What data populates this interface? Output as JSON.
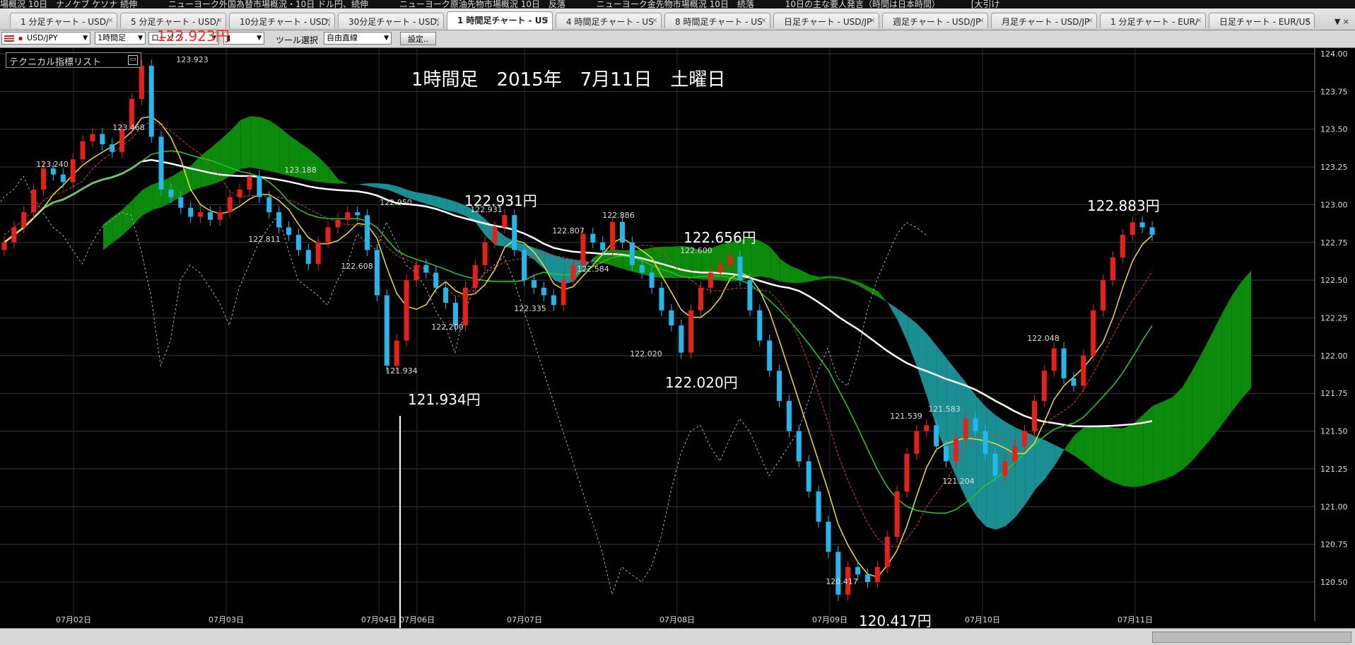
{
  "ticker": [
    "場概況 10日　ナノケブ ケソナ 続伸",
    "ニューヨーク外国為替市場概況・10日 ドル円、続伸",
    "ニューヨーク原油先物市場概況 10日　反落",
    "ニューヨーク金先物市場概況 10日　続落",
    "10日の主な要人発言（時間は日本時間）",
    "[大引け"
  ],
  "tabs": [
    {
      "label": "1 分足チャート - USD/"
    },
    {
      "label": "5 分足チャート - USD/"
    },
    {
      "label": "10分足チャート - USD,"
    },
    {
      "label": "30分足チャート - USD,"
    },
    {
      "label": "1 時間足チャート - US"
    },
    {
      "label": "4 時間足チャート - US"
    },
    {
      "label": "8 時間足チャート - US"
    },
    {
      "label": "日足チャート - USD/JP"
    },
    {
      "label": "週足チャート - USD/JP"
    },
    {
      "label": "月足チャート - USD/JP"
    },
    {
      "label": "1 分足チャート - EUR/"
    },
    {
      "label": "日足チャート - EUR/US"
    }
  ],
  "active_tab_index": 4,
  "toolbar": {
    "pair": "USD/JPY",
    "timeframe": "1時間足",
    "chart_kind": "ローソク",
    "tool_label": "ツール選択",
    "draw_mode": "自由直線",
    "settings": "設定.."
  },
  "red_price": "123.923円",
  "tech_list": "テクニカル指標リスト",
  "title": "1時間足　2015年　7月11日　土曜日",
  "annotations": {
    "a1": "122.931円",
    "a2": "122.656円",
    "a3": "122.020円",
    "a4": "121.934円",
    "a5": "122.883円",
    "a6": "120.417円"
  },
  "colors": {
    "background": "#000000",
    "up_candle": "#e8201a",
    "down_candle": "#22b8ee",
    "cloud_bull": "#0b8a0b",
    "cloud_bear": "#1a8f93",
    "ma_fast": "#f0e020",
    "ma_mid": "#22cc22",
    "ma_slow": "#ffffff",
    "grid": "#3a3a3a"
  },
  "chart_data": {
    "type": "candlestick",
    "symbol": "USD/JPY",
    "timeframe": "1時間足",
    "ylim": [
      120.417,
      124.0
    ],
    "yticks": [
      "124.00",
      "123.75",
      "123.50",
      "123.25",
      "123.00",
      "122.75",
      "122.50",
      "122.25",
      "122.00",
      "121.75",
      "121.50",
      "121.25",
      "121.00",
      "120.75",
      "120.50"
    ],
    "xticks": [
      "07月02日",
      "07月03日",
      "07月04日",
      "07月06日",
      "07月07日",
      "07月08日",
      "07月09日",
      "07月10日",
      "07月11日"
    ],
    "price_labels": [
      "123.923",
      "123.468",
      "123.240",
      "123.188",
      "122.950",
      "122.931",
      "122.886",
      "122.807",
      "122.811",
      "122.608",
      "122.584",
      "122.600",
      "122.335",
      "122.200",
      "122.020",
      "121.934",
      "121.539",
      "121.583",
      "121.204",
      "122.048",
      "120.417"
    ],
    "close_series": [
      122.75,
      122.85,
      122.95,
      123.1,
      123.24,
      123.2,
      123.15,
      123.3,
      123.42,
      123.468,
      123.4,
      123.35,
      123.5,
      123.7,
      123.92,
      123.45,
      123.1,
      123.05,
      122.98,
      122.92,
      122.95,
      122.9,
      122.95,
      123.05,
      123.1,
      123.188,
      123.05,
      122.95,
      122.85,
      122.8,
      122.7,
      122.608,
      122.75,
      122.85,
      122.9,
      122.95,
      122.93,
      122.7,
      122.4,
      121.934,
      122.1,
      122.5,
      122.6,
      122.55,
      122.45,
      122.35,
      122.2,
      122.45,
      122.6,
      122.75,
      122.85,
      122.931,
      122.7,
      122.5,
      122.45,
      122.4,
      122.335,
      122.5,
      122.6,
      122.807,
      122.75,
      122.7,
      122.886,
      122.75,
      122.6,
      122.55,
      122.45,
      122.3,
      122.2,
      122.02,
      122.3,
      122.45,
      122.55,
      122.6,
      122.656,
      122.5,
      122.3,
      122.1,
      121.9,
      121.7,
      121.5,
      121.3,
      121.1,
      120.9,
      120.7,
      120.417,
      120.6,
      120.55,
      120.5,
      120.6,
      120.8,
      121.1,
      121.35,
      121.5,
      121.539,
      121.4,
      121.3,
      121.45,
      121.583,
      121.5,
      121.35,
      121.204,
      121.3,
      121.4,
      121.5,
      121.7,
      121.9,
      122.048,
      121.85,
      121.8,
      122.0,
      122.3,
      122.5,
      122.65,
      122.8,
      122.883,
      122.85,
      122.8
    ]
  }
}
